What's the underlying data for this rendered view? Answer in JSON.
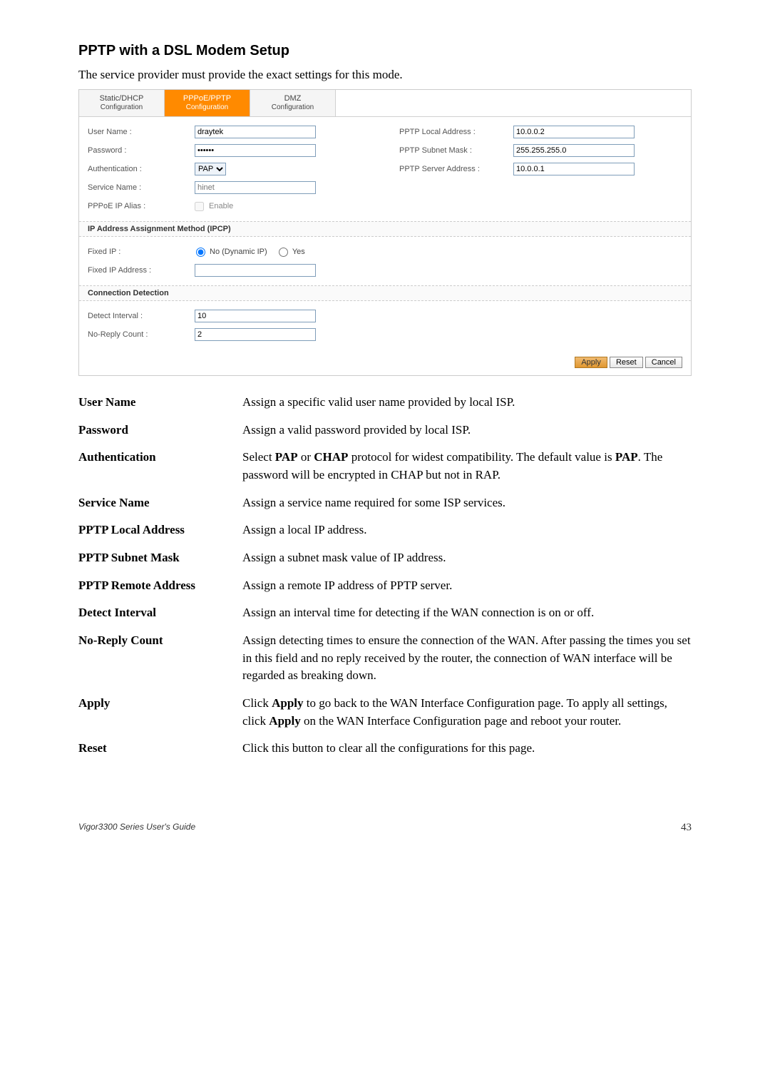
{
  "section_title": "PPTP with a DSL Modem Setup",
  "intro": "The service provider must provide the exact settings for this mode.",
  "screenshot": {
    "tabs": [
      {
        "line1": "Static/DHCP",
        "line2": "Configuration",
        "active": false
      },
      {
        "line1": "PPPoE/PPTP",
        "line2": "Configuration",
        "active": true
      },
      {
        "line1": "DMZ",
        "line2": "Configuration",
        "active": false
      }
    ],
    "left_fields": {
      "user_name_label": "User Name :",
      "user_name_value": "draytek",
      "password_label": "Password :",
      "password_value": "••••••",
      "auth_label": "Authentication :",
      "auth_value": "PAP",
      "service_label": "Service Name :",
      "service_placeholder": "hinet",
      "alias_label": "PPPoE IP Alias :",
      "alias_checkbox": "Enable"
    },
    "right_fields": {
      "local_label": "PPTP Local Address :",
      "local_value": "10.0.0.2",
      "subnet_label": "PPTP Subnet Mask :",
      "subnet_value": "255.255.255.0",
      "server_label": "PPTP Server Address :",
      "server_value": "10.0.0.1"
    },
    "ipcp_header": "IP Address Assignment Method (IPCP)",
    "ipcp": {
      "fixed_ip_label": "Fixed IP :",
      "radio_no": "No (Dynamic IP)",
      "radio_yes": "Yes",
      "fixed_addr_label": "Fixed IP Address :"
    },
    "conn_header": "Connection Detection",
    "conn": {
      "interval_label": "Detect Interval :",
      "interval_value": "10",
      "noreply_label": "No-Reply Count :",
      "noreply_value": "2"
    },
    "buttons": {
      "apply": "Apply",
      "reset": "Reset",
      "cancel": "Cancel"
    }
  },
  "definitions": [
    {
      "term": "User Name",
      "desc": "Assign a specific valid user name provided by local ISP."
    },
    {
      "term": "Password",
      "desc": "Assign a valid password provided by local ISP."
    },
    {
      "term": "Authentication",
      "desc": "Select <b>PAP</b> or <b>CHAP</b> protocol for widest compatibility. The default value is <b>PAP</b>. The password will be encrypted in CHAP but not in RAP."
    },
    {
      "term": "Service Name",
      "desc": "Assign a service name required for some ISP services."
    },
    {
      "term": "PPTP Local Address",
      "desc": "Assign a local IP address."
    },
    {
      "term": "PPTP Subnet Mask",
      "desc": "Assign a subnet mask value of IP address."
    },
    {
      "term": "PPTP Remote Address",
      "desc": "Assign a remote IP address of PPTP server."
    },
    {
      "term": "Detect Interval",
      "desc": "Assign an interval time for detecting if the WAN connection is on or off."
    },
    {
      "term": "No-Reply Count",
      "desc": "Assign detecting times to ensure the connection of the WAN. After passing the times you set in this field and no reply received by the router, the connection of WAN interface will be regarded as breaking down."
    },
    {
      "term": "Apply",
      "desc": "Click <b>Apply</b> to go back to the WAN Interface Configuration page. To apply all settings, click <b>Apply</b> on the WAN Interface Configuration page and reboot your router."
    },
    {
      "term": "Reset",
      "desc": "Click this button to clear all the configurations for this page."
    }
  ],
  "footer": {
    "guide": "Vigor3300 Series User's Guide",
    "page": "43"
  }
}
